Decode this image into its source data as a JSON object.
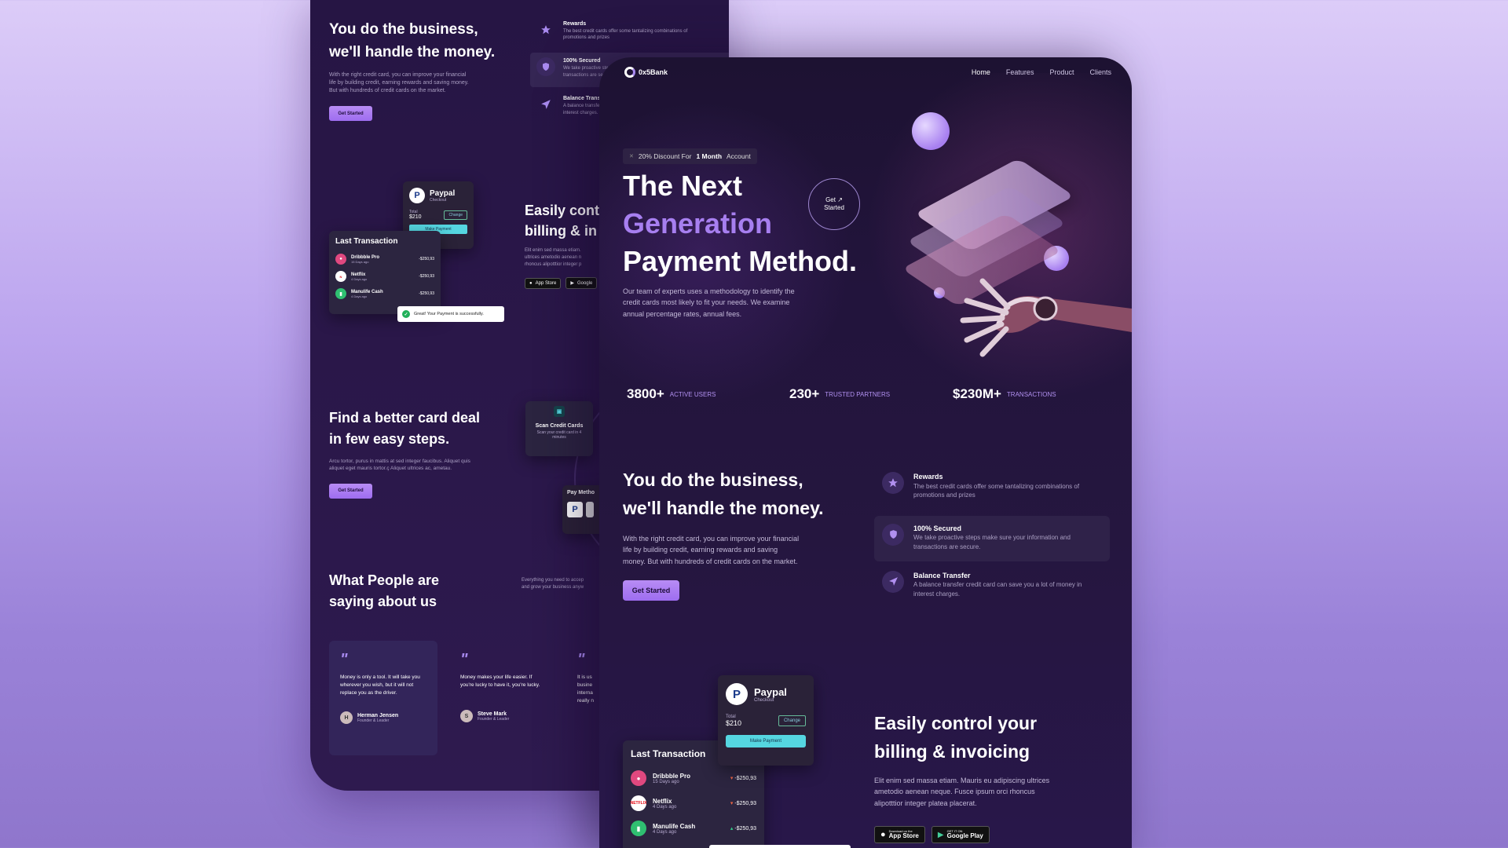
{
  "back": {
    "hero_title": [
      "You do the business,",
      "we'll handle the money."
    ],
    "hero_text": "With the right credit card, you can improve your financial life by building credit, earning rewards and saving money. But with hundreds of credit cards on the market.",
    "get_started": "Get Started",
    "features": [
      {
        "title": "Rewards",
        "text": "The best credit cards offer some tantalizing combinations of promotions and prizes"
      },
      {
        "title": "100% Secured",
        "text": "We take proactive steps make sure your information and transactions are secure."
      },
      {
        "title": "Balance Transfer",
        "text": "A balance transfer credit card can save you a lot of money in interest charges."
      }
    ],
    "paypal": {
      "title": "Paypal",
      "subtitle": "Checkout",
      "total_label": "Total",
      "total": "$210",
      "change": "Change",
      "pay": "Make Payment"
    },
    "last_tx": {
      "title": "Last Transaction",
      "items": [
        {
          "name": "Dribbble Pro",
          "date": "15 Days ago",
          "amount": "-$250,93"
        },
        {
          "name": "Netflix",
          "date": "4 Days ago",
          "amount": "-$250,93"
        },
        {
          "name": "Manulife Cash",
          "date": "4 Days ago",
          "amount": "-$250,93"
        }
      ]
    },
    "toast": "Great! Your Payment is successfully.",
    "billing_title": [
      "Easily cont",
      "billing & in"
    ],
    "billing_text": [
      "Elit enim sed massa etiam.",
      "ultrices ametodio aenean n",
      "rhoncus alipotttior integer p"
    ],
    "app_store": "App Store",
    "google_play": "Google",
    "find_title": [
      "Find a better card deal",
      "in few easy steps."
    ],
    "find_text": "Arcu tortor, purus in mattis at sed integer faucibus. Aliquet quis aliquet eget mauris tortor.ç Aliquet ultrices ac, ametau.",
    "scan": {
      "title": "Scan Credit Cards",
      "text": "Scan your credit card in 4 minutes"
    },
    "pay_method": "Pay Metho",
    "testimonials_title": [
      "What People are",
      "saying about us"
    ],
    "testimonials_side": [
      "Everything you need to accep",
      "and grow your business anyw"
    ],
    "quotes": [
      {
        "text": "Money is only a tool. It will take you wherever you wish, but it will not replace you as the driver.",
        "name": "Herman Jensen",
        "role": "Founder & Leader"
      },
      {
        "text": "Money makes your life easier. If you're lucky to have it, you're lucky.",
        "name": "Steve Mark",
        "role": "Founder & Leader"
      },
      {
        "text": "It is us busine interna really n",
        "name": "",
        "role": ""
      }
    ]
  },
  "front": {
    "logo": "0x5Bank",
    "nav": [
      "Home",
      "Features",
      "Product",
      "Clients"
    ],
    "badge": {
      "pre": "20% Discount For",
      "bold": "1 Month",
      "post": "Account"
    },
    "hero_line1": "The Next",
    "hero_line2": "Generation",
    "hero_line3": "Payment Method.",
    "hero_text": "Our team of experts uses a methodology to identify the credit cards most likely to fit your needs. We examine annual percentage rates, annual fees.",
    "circle_btn": [
      "Get ↗",
      "Started"
    ],
    "stats": [
      {
        "value": "3800+",
        "label": "ACTIVE USERS"
      },
      {
        "value": "230+",
        "label": "TRUSTED PARTNERS"
      },
      {
        "value": "$230M+",
        "label": "TRANSACTIONS"
      }
    ],
    "business_title": [
      "You do the business,",
      "we'll handle the money."
    ],
    "business_text": "With the right credit card, you can improve your financial life by building credit, earning rewards and saving money. But with hundreds of credit cards on the market.",
    "get_started": "Get Started",
    "features": [
      {
        "title": "Rewards",
        "text": "The best credit cards offer some tantalizing combinations of promotions and prizes"
      },
      {
        "title": "100% Secured",
        "text": "We take proactive steps make sure your information and transactions are secure."
      },
      {
        "title": "Balance Transfer",
        "text": "A balance transfer credit card can save you a lot of money in interest charges."
      }
    ],
    "paypal": {
      "title": "Paypal",
      "subtitle": "Checkout",
      "total_label": "Total",
      "total": "$210",
      "change": "Change",
      "pay": "Make Payment"
    },
    "last_tx": {
      "title": "Last Transaction",
      "items": [
        {
          "name": "Dribbble Pro",
          "date": "15 Days ago",
          "amount": "-$250,93"
        },
        {
          "name": "Netflix",
          "date": "4 Days ago",
          "amount": "-$250,93"
        },
        {
          "name": "Manulife Cash",
          "date": "4 Days ago",
          "amount": "-$250,93"
        }
      ]
    },
    "billing_title": [
      "Easily control your",
      "billing & invoicing"
    ],
    "billing_text": "Elit enim sed massa etiam. Mauris eu adipiscing ultrices ametodio aenean neque. Fusce ipsum orci rhoncus alipotttior integer platea placerat.",
    "app_store": "App Store",
    "google_play": "Google Play",
    "store_small": "Download on the",
    "gp_small": "GET IT ON"
  },
  "colors": {
    "accent": "#9e6df0",
    "accent_light": "#b88cf4",
    "teal": "#55d6e0",
    "bg_dark": "#1d1232"
  }
}
